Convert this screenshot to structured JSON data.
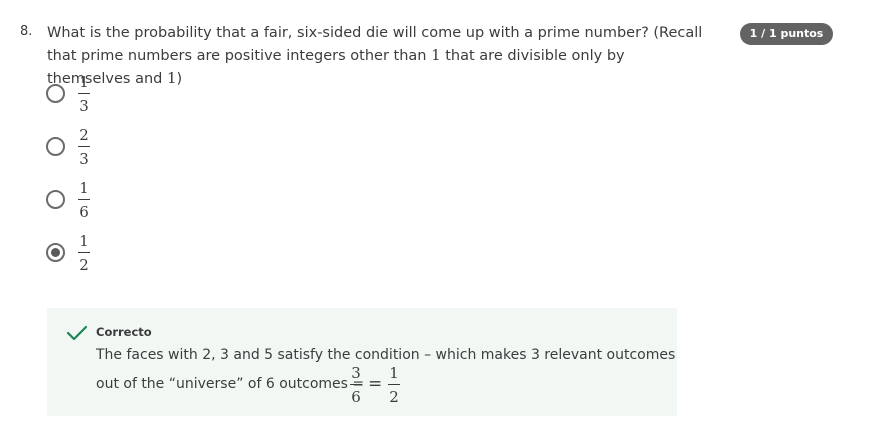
{
  "question": {
    "number": "8.",
    "text_part1": "What is the probability that a fair, six-sided die will come up with a prime number? (Recall that prime numbers are positive integers other than ",
    "math_one_a": "1",
    "text_part2": " that are divisible only by themselves and ",
    "math_one_b": "1",
    "text_part3": ")"
  },
  "score_badge": "1 / 1 puntos",
  "options": [
    {
      "numerator": "1",
      "denominator": "3",
      "selected": false
    },
    {
      "numerator": "2",
      "denominator": "3",
      "selected": false
    },
    {
      "numerator": "1",
      "denominator": "6",
      "selected": false
    },
    {
      "numerator": "1",
      "denominator": "2",
      "selected": true
    }
  ],
  "feedback": {
    "status": "Correcto",
    "line1": "The faces with 2, 3 and 5 satisfy the condition – which makes 3 relevant outcomes",
    "line2": "out of the “universe” of 6 outcomes =",
    "frac1": {
      "numerator": "3",
      "denominator": "6"
    },
    "equals": "=",
    "frac2": {
      "numerator": "1",
      "denominator": "2"
    },
    "accent_color": "#1f8354",
    "background_color": "#f1f8f4"
  },
  "colors": {
    "text": "#3c3c3c",
    "badge_bg": "#636363",
    "badge_text": "#ffffff"
  },
  "icons": {
    "feedback_icon": "checkmark-icon",
    "option_icon": "radio-button-icon"
  }
}
